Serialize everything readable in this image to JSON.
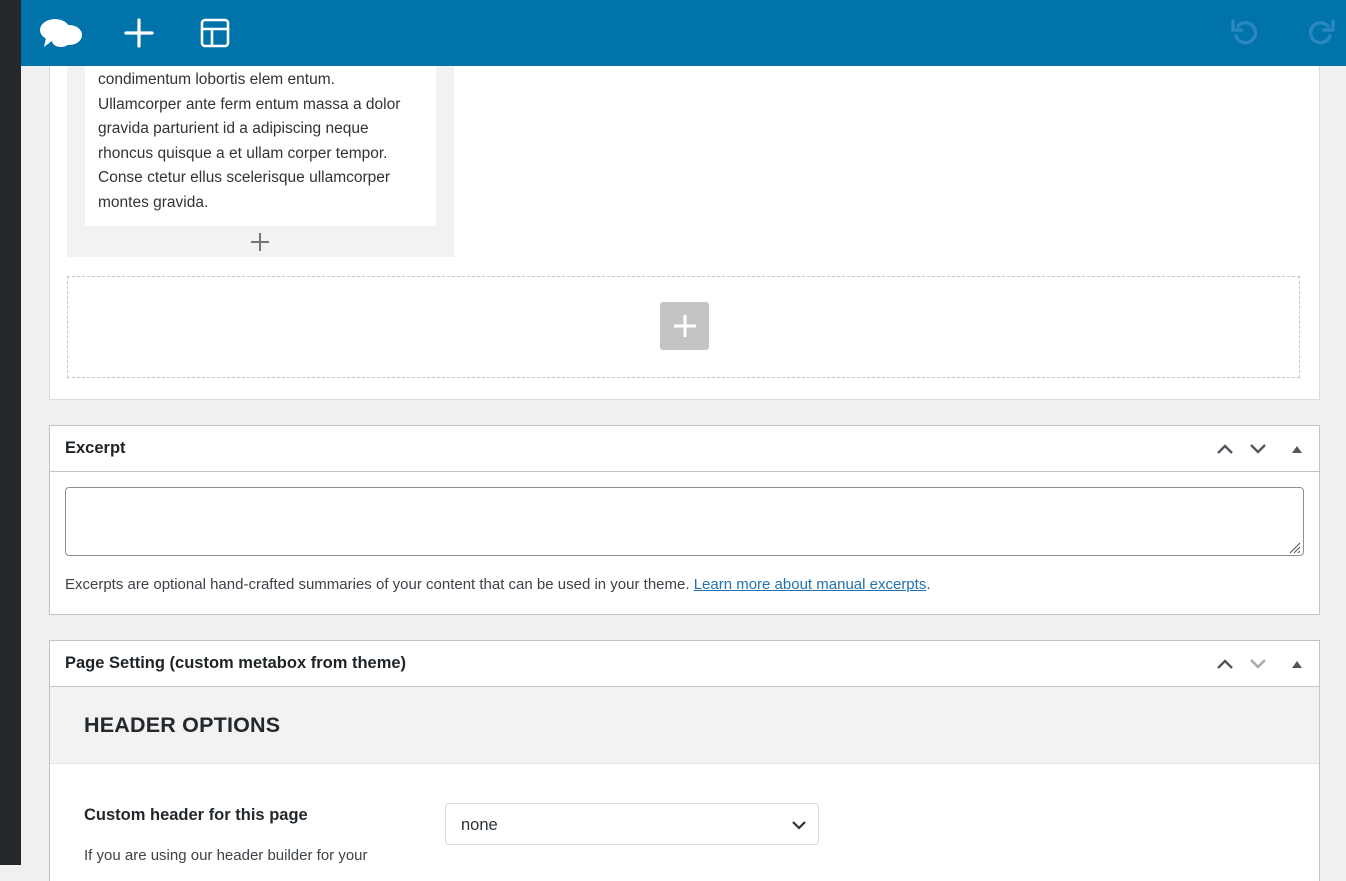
{
  "toolbar": {
    "icons": [
      "builder-logo-icon",
      "plus-icon",
      "layout-icon",
      "undo-icon",
      "redo-icon"
    ],
    "color": "#0073aa"
  },
  "builder": {
    "text_block": {
      "lines": [
        "condimentum lobortis elem entum.",
        "Ullamcorper ante ferm entum massa a dolor",
        "gravida parturient id a adipiscing neque",
        "rhoncus quisque a et ullam corper tempor.",
        "Conse ctetur ellus scelerisque ullamcorper",
        "montes gravida."
      ]
    }
  },
  "excerpt": {
    "title": "Excerpt",
    "textarea_value": "",
    "help_text": "Excerpts are optional hand-crafted summaries of your content that can be used in your theme. ",
    "help_link": "Learn more about manual excerpts",
    "help_end": "."
  },
  "page_setting": {
    "title": "Page Setting (custom metabox from theme)",
    "section_heading": "HEADER OPTIONS",
    "custom_header": {
      "label": "Custom header for this page",
      "description": "If you are using our header builder for your",
      "selected": "none"
    }
  }
}
